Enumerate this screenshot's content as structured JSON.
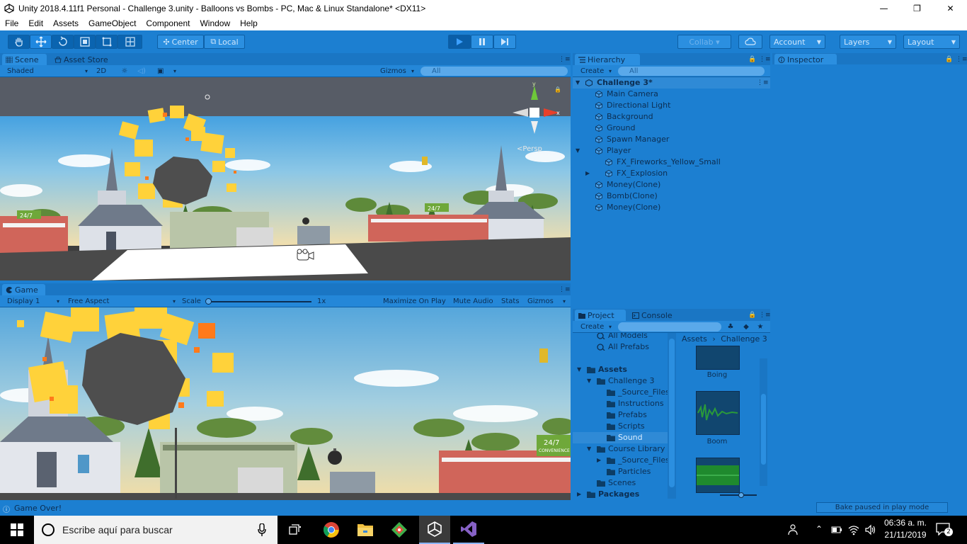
{
  "window": {
    "title": "Unity 2018.4.11f1 Personal - Challenge 3.unity - Balloons vs Bombs - PC, Mac & Linux Standalone* <DX11>",
    "minimize_glyph": "—",
    "maximize_glyph": "❐",
    "close_glyph": "✕"
  },
  "menu": [
    "File",
    "Edit",
    "Assets",
    "GameObject",
    "Component",
    "Window",
    "Help"
  ],
  "toolbar": {
    "tools": [
      "hand-tool-icon",
      "move-tool-icon",
      "rotate-tool-icon",
      "scale-tool-icon",
      "rect-tool-icon",
      "transform-tool-icon"
    ],
    "pivot_center": "Center",
    "pivot_local": "Local",
    "collab": "Collab ▾",
    "account": "Account",
    "layers": "Layers",
    "layout": "Layout"
  },
  "scene_panel": {
    "tab_scene": "Scene",
    "tab_asset_store": "Asset Store",
    "shading": "Shaded",
    "mode_2d": "2D",
    "gizmos": "Gizmos",
    "search_placeholder": "All",
    "persp_label": "Persp",
    "axis_y": "y",
    "axis_x": "x"
  },
  "game_panel": {
    "tab": "Game",
    "display": "Display 1",
    "aspect": "Free Aspect",
    "scale_label": "Scale",
    "scale_value": "1x",
    "maximize_on_play": "Maximize On Play",
    "mute_audio": "Mute Audio",
    "stats": "Stats",
    "gizmos": "Gizmos"
  },
  "scene_signs": {
    "store_sign": "24/7",
    "store_sub": "CONVENIENCE"
  },
  "hierarchy": {
    "tab": "Hierarchy",
    "create": "Create",
    "search_placeholder": "All",
    "scene_name": "Challenge 3*",
    "items": [
      {
        "label": "Main Camera",
        "depth": 1,
        "expander": ""
      },
      {
        "label": "Directional Light",
        "depth": 1,
        "expander": ""
      },
      {
        "label": "Background",
        "depth": 1,
        "expander": ""
      },
      {
        "label": "Ground",
        "depth": 1,
        "expander": ""
      },
      {
        "label": "Spawn Manager",
        "depth": 1,
        "expander": ""
      },
      {
        "label": "Player",
        "depth": 1,
        "expander": "open"
      },
      {
        "label": "FX_Fireworks_Yellow_Small",
        "depth": 2,
        "expander": ""
      },
      {
        "label": "FX_Explosion",
        "depth": 2,
        "expander": "closed"
      },
      {
        "label": "Money(Clone)",
        "depth": 1,
        "expander": ""
      },
      {
        "label": "Bomb(Clone)",
        "depth": 1,
        "expander": ""
      },
      {
        "label": "Money(Clone)",
        "depth": 1,
        "expander": ""
      }
    ]
  },
  "inspector": {
    "tab": "Inspector"
  },
  "project": {
    "tab_project": "Project",
    "tab_console": "Console",
    "create": "Create",
    "tree": [
      {
        "label": "All Models",
        "depth": 1,
        "kind": "search",
        "expander": ""
      },
      {
        "label": "All Prefabs",
        "depth": 1,
        "kind": "search",
        "expander": ""
      },
      {
        "label": "",
        "depth": 0,
        "kind": "spacer",
        "expander": ""
      },
      {
        "label": "Assets",
        "depth": 0,
        "kind": "folder-bold",
        "expander": "open"
      },
      {
        "label": "Challenge 3",
        "depth": 1,
        "kind": "folder",
        "expander": "open"
      },
      {
        "label": "_Source_Files",
        "depth": 2,
        "kind": "folder",
        "expander": ""
      },
      {
        "label": "Instructions",
        "depth": 2,
        "kind": "folder",
        "expander": ""
      },
      {
        "label": "Prefabs",
        "depth": 2,
        "kind": "folder",
        "expander": ""
      },
      {
        "label": "Scripts",
        "depth": 2,
        "kind": "folder",
        "expander": ""
      },
      {
        "label": "Sound",
        "depth": 2,
        "kind": "folder",
        "expander": "",
        "selected": true
      },
      {
        "label": "Course Library",
        "depth": 1,
        "kind": "folder",
        "expander": "open"
      },
      {
        "label": "_Source_Files",
        "depth": 2,
        "kind": "folder",
        "expander": "closed"
      },
      {
        "label": "Particles",
        "depth": 2,
        "kind": "folder",
        "expander": ""
      },
      {
        "label": "Scenes",
        "depth": 1,
        "kind": "folder",
        "expander": ""
      },
      {
        "label": "Packages",
        "depth": 0,
        "kind": "folder-bold",
        "expander": "closed"
      }
    ],
    "breadcrumb": [
      "Assets",
      "Challenge 3"
    ],
    "assets": [
      {
        "label": "Boing",
        "kind": "audio"
      },
      {
        "label": "Boom",
        "kind": "audio-wave"
      },
      {
        "label": "",
        "kind": "audio-green"
      }
    ]
  },
  "status": {
    "message": "Game Over!",
    "bake": "Bake paused in play mode"
  },
  "taskbar": {
    "search_placeholder": "Escribe aquí para buscar",
    "time": "06:36 a. m.",
    "date": "21/11/2019",
    "notifications": "2"
  }
}
